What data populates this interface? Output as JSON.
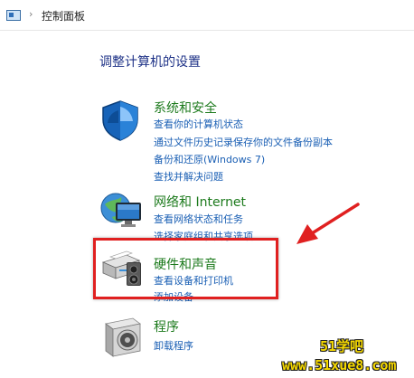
{
  "breadcrumb": {
    "icon": "control-panel-icon",
    "chevron": "›",
    "current": "控制面板"
  },
  "heading": "调整计算机的设置",
  "categories": [
    {
      "icon": "system-security-shield-icon",
      "title": "系统和安全",
      "links": [
        "查看你的计算机状态",
        "通过文件历史记录保存你的文件备份副本",
        "备份和还原(Windows 7)",
        "查找并解决问题"
      ]
    },
    {
      "icon": "network-globe-icon",
      "title": "网络和 Internet",
      "links": [
        "查看网络状态和任务",
        "选择家庭组和共享选项"
      ]
    },
    {
      "icon": "printer-speaker-icon",
      "title": "硬件和声音",
      "links": [
        "查看设备和打印机",
        "添加设备"
      ]
    },
    {
      "icon": "programs-disk-icon",
      "title": "程序",
      "links": [
        "卸载程序"
      ]
    }
  ],
  "annotation": {
    "arrow_color": "#e02020",
    "box_color": "#e02020"
  },
  "watermark": {
    "line1": "51学吧",
    "line2": "www.51xue8.com"
  },
  "colors": {
    "category_title": "#1c7a1c",
    "link": "#1a5fb4",
    "heading": "#1e3287"
  }
}
